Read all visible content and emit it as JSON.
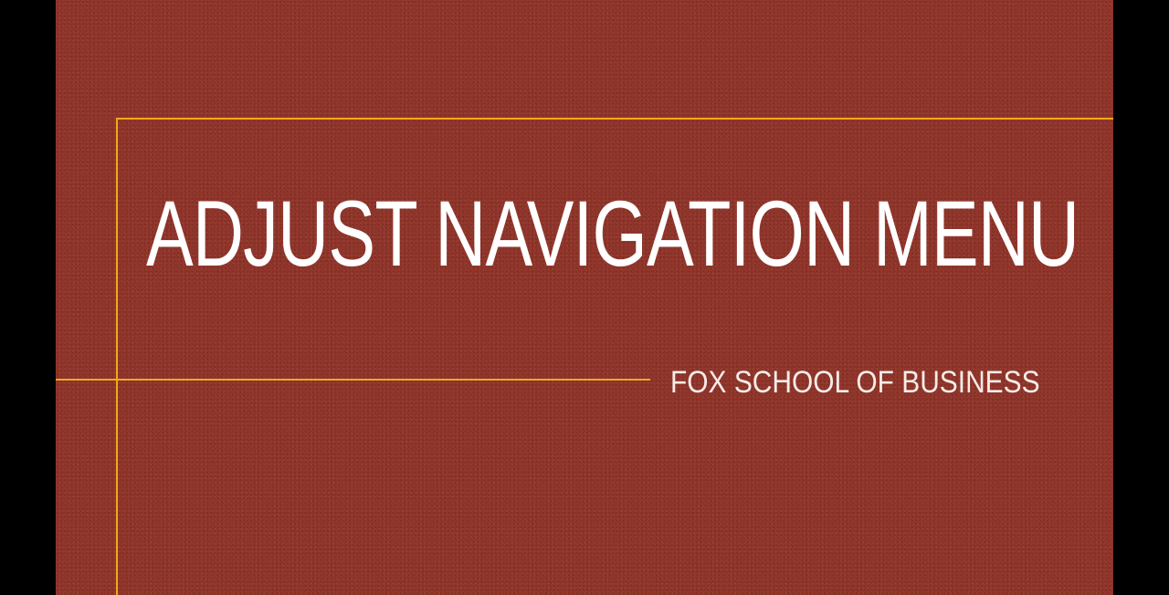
{
  "slide": {
    "title": "ADJUST NAVIGATION MENU",
    "subtitle": "FOX SCHOOL OF BUSINESS"
  },
  "colors": {
    "background": "#94362b",
    "accent_lines": "#f2a81a",
    "letterbox": "#000000",
    "text": "#ffffff"
  }
}
